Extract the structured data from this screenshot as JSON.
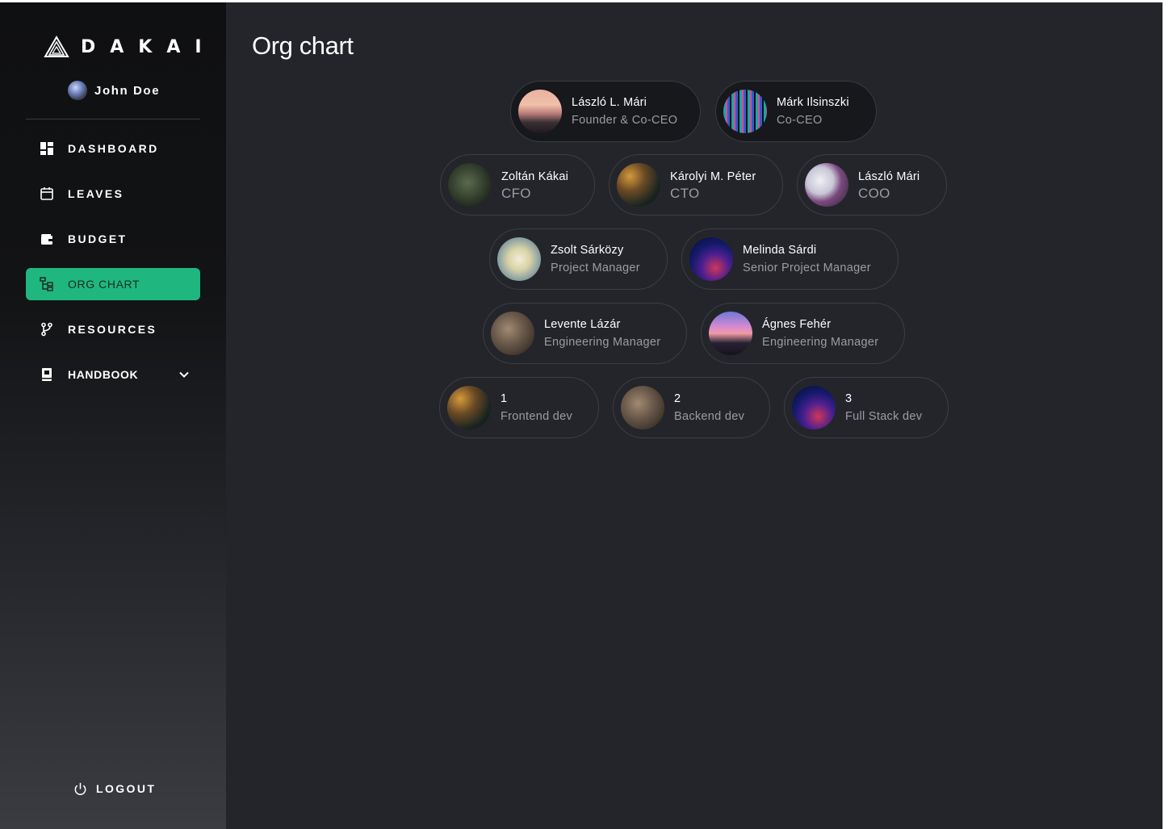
{
  "brand": {
    "name": "DAKAI",
    "logo_icon": "triangle-logo-icon"
  },
  "user": {
    "name": "John Doe",
    "avatar_icon": "user-avatar"
  },
  "nav": {
    "items": [
      {
        "label": "DASHBOARD",
        "icon": "dashboard-icon"
      },
      {
        "label": "LEAVES",
        "icon": "calendar-icon"
      },
      {
        "label": "BUDGET",
        "icon": "wallet-icon"
      },
      {
        "label": "ORG CHART",
        "icon": "org-chart-icon",
        "active": true
      },
      {
        "label": "RESOURCES",
        "icon": "branch-icon"
      },
      {
        "label": "HANDBOOK",
        "icon": "book-icon",
        "expandable": true
      }
    ],
    "logout_label": "LOGOUT"
  },
  "page": {
    "title": "Org chart"
  },
  "org": {
    "people": [
      {
        "name": "László L. Mári",
        "role": "Founder & Co-CEO",
        "photo": "sunset"
      },
      {
        "name": "Márk Ilsinszki",
        "role": "Co-CEO",
        "photo": "neon"
      },
      {
        "name": "Zoltán Kákai",
        "role": "CFO",
        "photo": "moss"
      },
      {
        "name": "Károlyi M. Péter",
        "role": "CTO",
        "photo": "bar"
      },
      {
        "name": "László Mári",
        "role": "COO",
        "photo": "flowers"
      },
      {
        "name": "Zsolt Sárközy",
        "role": "Project Manager",
        "photo": "blossom"
      },
      {
        "name": "Melinda Sárdi",
        "role": "Senior Project Manager",
        "photo": "laser"
      },
      {
        "name": "Levente Lázár",
        "role": "Engineering Manager",
        "photo": "room"
      },
      {
        "name": "Ágnes Fehér",
        "role": "Engineering Manager",
        "photo": "dusk"
      },
      {
        "name": "1",
        "role": "Frontend dev",
        "photo": "bar"
      },
      {
        "name": "2",
        "role": "Backend dev",
        "photo": "room"
      },
      {
        "name": "3",
        "role": "Full Stack dev",
        "photo": "laser"
      }
    ]
  },
  "colors": {
    "accent": "#1fb77f",
    "background": "#23252b",
    "sidebar": "#121315"
  }
}
